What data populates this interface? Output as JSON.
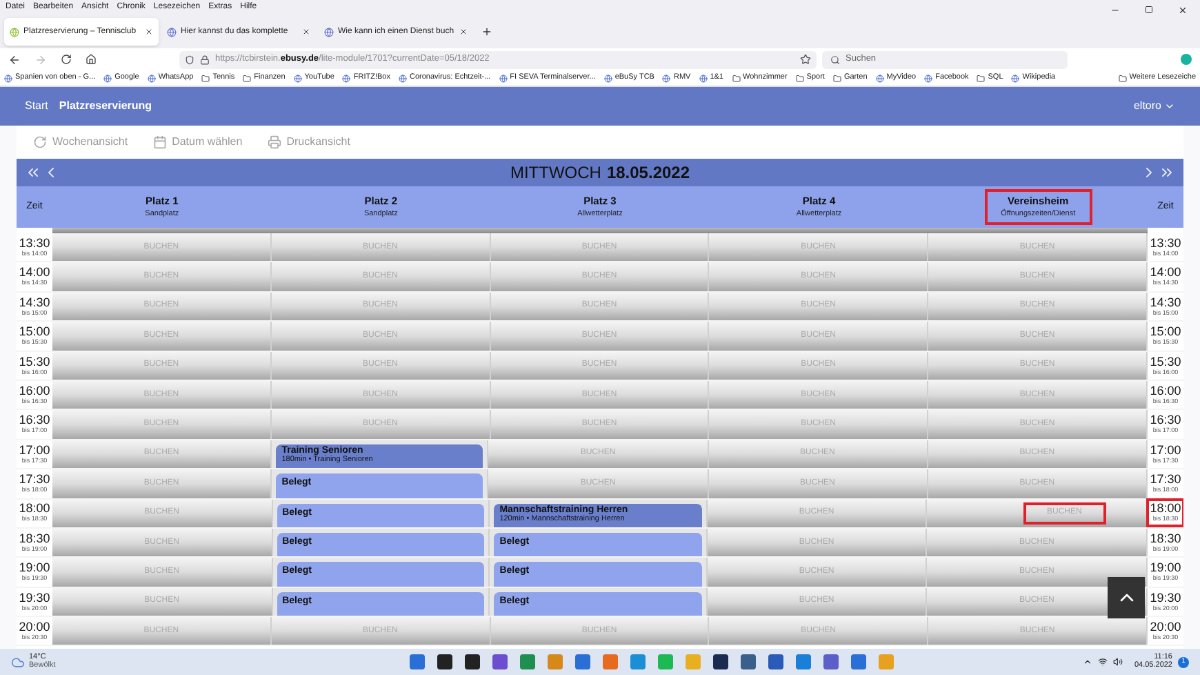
{
  "menu": [
    "Datei",
    "Bearbeiten",
    "Ansicht",
    "Chronik",
    "Lesezeichen",
    "Extras",
    "Hilfe"
  ],
  "tabs": [
    {
      "label": "Platzreservierung – Tennisclub",
      "selected": true
    },
    {
      "label": "Hier kannst du das komplette",
      "selected": false
    },
    {
      "label": "Wie kann ich einen Dienst buch",
      "selected": false
    }
  ],
  "address": {
    "url": "https://tcbirstein.**ebusy.de**/lite-module/1701?currentDate=05/18/2022"
  },
  "search": {
    "placeholder": "Suchen"
  },
  "bookmarks": [
    {
      "label": "Spanien von oben - G...",
      "kind": "site"
    },
    {
      "label": "Google",
      "kind": "site"
    },
    {
      "label": "WhatsApp",
      "kind": "site"
    },
    {
      "label": "Tennis",
      "kind": "folder"
    },
    {
      "label": "Finanzen",
      "kind": "folder"
    },
    {
      "label": "YouTube",
      "kind": "site"
    },
    {
      "label": "FRITZ!Box",
      "kind": "site"
    },
    {
      "label": "Coronavirus: Echtzeit-...",
      "kind": "site"
    },
    {
      "label": "FI SEVA Terminalserver...",
      "kind": "site"
    },
    {
      "label": "eBuSy TCB",
      "kind": "site"
    },
    {
      "label": "RMV",
      "kind": "site"
    },
    {
      "label": "1&1",
      "kind": "site"
    },
    {
      "label": "Wohnzimmer",
      "kind": "folder"
    },
    {
      "label": "Sport",
      "kind": "folder"
    },
    {
      "label": "Garten",
      "kind": "folder"
    },
    {
      "label": "MyVideo",
      "kind": "site"
    },
    {
      "label": "Facebook",
      "kind": "site"
    },
    {
      "label": "SQL",
      "kind": "folder"
    },
    {
      "label": "Wikipedia",
      "kind": "site"
    }
  ],
  "more_bookmarks": "Weitere Lesezeiche",
  "app_nav": {
    "items": [
      {
        "label": "Start",
        "selected": false
      },
      {
        "label": "Platzreservierung",
        "selected": true
      }
    ],
    "user": "eltoro"
  },
  "toolbar": [
    "Wochenansicht",
    "Datum wählen",
    "Druckansicht"
  ],
  "date_bar": {
    "weekday": "MITTWOCH",
    "date": "18.05.2022"
  },
  "time_heading": "Zeit",
  "time_heading_right": "Zeit",
  "courts": [
    {
      "name": "Platz 1",
      "type": "Sandplatz",
      "highlighted": false
    },
    {
      "name": "Platz 2",
      "type": "Sandplatz",
      "highlighted": false
    },
    {
      "name": "Platz 3",
      "type": "Allwetterplatz",
      "highlighted": false
    },
    {
      "name": "Platz 4",
      "type": "Allwetterplatz",
      "highlighted": false
    },
    {
      "name": "Vereinsheim",
      "type": "Öffnungszeiten/Dienst",
      "highlighted": true
    }
  ],
  "rows": [
    {
      "time": "13:30",
      "until": "bis 14:00",
      "cells": [
        {
          "kind": "free",
          "label": "BUCHEN",
          "highlighted": false
        },
        {
          "kind": "free",
          "label": "BUCHEN",
          "highlighted": false
        },
        {
          "kind": "free",
          "label": "BUCHEN",
          "highlighted": false
        },
        {
          "kind": "free",
          "label": "BUCHEN",
          "highlighted": false
        },
        {
          "kind": "free",
          "label": "BUCHEN",
          "highlighted": false
        }
      ]
    },
    {
      "time": "14:00",
      "until": "bis 14:30",
      "cells": [
        {
          "kind": "free",
          "label": "BUCHEN",
          "highlighted": false
        },
        {
          "kind": "free",
          "label": "BUCHEN",
          "highlighted": false
        },
        {
          "kind": "free",
          "label": "BUCHEN",
          "highlighted": false
        },
        {
          "kind": "free",
          "label": "BUCHEN",
          "highlighted": false
        },
        {
          "kind": "free",
          "label": "BUCHEN",
          "highlighted": false
        }
      ]
    },
    {
      "time": "14:30",
      "until": "bis 15:00",
      "cells": [
        {
          "kind": "free",
          "label": "BUCHEN",
          "highlighted": false
        },
        {
          "kind": "free",
          "label": "BUCHEN",
          "highlighted": false
        },
        {
          "kind": "free",
          "label": "BUCHEN",
          "highlighted": false
        },
        {
          "kind": "free",
          "label": "BUCHEN",
          "highlighted": false
        },
        {
          "kind": "free",
          "label": "BUCHEN",
          "highlighted": false
        }
      ]
    },
    {
      "time": "15:00",
      "until": "bis 15:30",
      "cells": [
        {
          "kind": "free",
          "label": "BUCHEN",
          "highlighted": false
        },
        {
          "kind": "free",
          "label": "BUCHEN",
          "highlighted": false
        },
        {
          "kind": "free",
          "label": "BUCHEN",
          "highlighted": false
        },
        {
          "kind": "free",
          "label": "BUCHEN",
          "highlighted": false
        },
        {
          "kind": "free",
          "label": "BUCHEN",
          "highlighted": false
        }
      ]
    },
    {
      "time": "15:30",
      "until": "bis 16:00",
      "cells": [
        {
          "kind": "free",
          "label": "BUCHEN",
          "highlighted": false
        },
        {
          "kind": "free",
          "label": "BUCHEN",
          "highlighted": false
        },
        {
          "kind": "free",
          "label": "BUCHEN",
          "highlighted": false
        },
        {
          "kind": "free",
          "label": "BUCHEN",
          "highlighted": false
        },
        {
          "kind": "free",
          "label": "BUCHEN",
          "highlighted": false
        }
      ]
    },
    {
      "time": "16:00",
      "until": "bis 16:30",
      "cells": [
        {
          "kind": "free",
          "label": "BUCHEN",
          "highlighted": false
        },
        {
          "kind": "free",
          "label": "BUCHEN",
          "highlighted": false
        },
        {
          "kind": "free",
          "label": "BUCHEN",
          "highlighted": false
        },
        {
          "kind": "free",
          "label": "BUCHEN",
          "highlighted": false
        },
        {
          "kind": "free",
          "label": "BUCHEN",
          "highlighted": false
        }
      ]
    },
    {
      "time": "16:30",
      "until": "bis 17:00",
      "cells": [
        {
          "kind": "free",
          "label": "BUCHEN",
          "highlighted": false
        },
        {
          "kind": "free",
          "label": "BUCHEN",
          "highlighted": false
        },
        {
          "kind": "free",
          "label": "BUCHEN",
          "highlighted": false
        },
        {
          "kind": "free",
          "label": "BUCHEN",
          "highlighted": false
        },
        {
          "kind": "free",
          "label": "BUCHEN",
          "highlighted": false
        }
      ]
    },
    {
      "time": "17:00",
      "until": "bis 17:30",
      "cells": [
        {
          "kind": "free",
          "label": "BUCHEN",
          "highlighted": false
        },
        {
          "kind": "booking",
          "title": "Training Senioren",
          "detail": "180min • Training Senioren"
        },
        {
          "kind": "free",
          "label": "BUCHEN",
          "highlighted": false
        },
        {
          "kind": "free",
          "label": "BUCHEN",
          "highlighted": false
        },
        {
          "kind": "free",
          "label": "BUCHEN",
          "highlighted": false
        }
      ]
    },
    {
      "time": "17:30",
      "until": "bis 18:00",
      "cells": [
        {
          "kind": "free",
          "label": "BUCHEN",
          "highlighted": false
        },
        {
          "kind": "occupied",
          "title": "Belegt"
        },
        {
          "kind": "free",
          "label": "BUCHEN",
          "highlighted": false
        },
        {
          "kind": "free",
          "label": "BUCHEN",
          "highlighted": false
        },
        {
          "kind": "free",
          "label": "BUCHEN",
          "highlighted": false
        }
      ]
    },
    {
      "time": "18:00",
      "until": "bis 18:30",
      "cells": [
        {
          "kind": "free",
          "label": "BUCHEN",
          "highlighted": false
        },
        {
          "kind": "occupied",
          "title": "Belegt"
        },
        {
          "kind": "booking",
          "title": "Mannschaftstraining Herren",
          "detail": "120min • Mannschaftstraining Herren"
        },
        {
          "kind": "free",
          "label": "BUCHEN",
          "highlighted": false
        },
        {
          "kind": "free",
          "label": "BUCHEN",
          "highlighted": true
        }
      ]
    },
    {
      "time": "18:30",
      "until": "bis 19:00",
      "cells": [
        {
          "kind": "free",
          "label": "BUCHEN",
          "highlighted": false
        },
        {
          "kind": "occupied",
          "title": "Belegt"
        },
        {
          "kind": "occupied",
          "title": "Belegt"
        },
        {
          "kind": "free",
          "label": "BUCHEN",
          "highlighted": false
        },
        {
          "kind": "free",
          "label": "BUCHEN",
          "highlighted": false
        }
      ]
    },
    {
      "time": "19:00",
      "until": "bis 19:30",
      "cells": [
        {
          "kind": "free",
          "label": "BUCHEN",
          "highlighted": false
        },
        {
          "kind": "occupied",
          "title": "Belegt"
        },
        {
          "kind": "occupied",
          "title": "Belegt"
        },
        {
          "kind": "free",
          "label": "BUCHEN",
          "highlighted": false
        },
        {
          "kind": "free",
          "label": "BUCHEN",
          "highlighted": false
        }
      ]
    },
    {
      "time": "19:30",
      "until": "bis 20:00",
      "cells": [
        {
          "kind": "free",
          "label": "BUCHEN",
          "highlighted": false
        },
        {
          "kind": "occupied",
          "title": "Belegt"
        },
        {
          "kind": "occupied",
          "title": "Belegt"
        },
        {
          "kind": "free",
          "label": "BUCHEN",
          "highlighted": false
        },
        {
          "kind": "free",
          "label": "BUCHEN",
          "highlighted": false
        }
      ]
    },
    {
      "time": "20:00",
      "until": "bis 20:30",
      "cells": [
        {
          "kind": "free",
          "label": "BUCHEN",
          "highlighted": false
        },
        {
          "kind": "free",
          "label": "BUCHEN",
          "highlighted": false
        },
        {
          "kind": "free",
          "label": "BUCHEN",
          "highlighted": false
        },
        {
          "kind": "free",
          "label": "BUCHEN",
          "highlighted": false
        },
        {
          "kind": "free",
          "label": "BUCHEN",
          "highlighted": false
        }
      ]
    }
  ],
  "right_times": [
    {
      "time": "13:30",
      "until": "bis 14:00",
      "highlighted": false
    },
    {
      "time": "14:00",
      "until": "bis 14:30",
      "highlighted": false
    },
    {
      "time": "14:30",
      "until": "bis 15:00",
      "highlighted": false
    },
    {
      "time": "15:00",
      "until": "bis 15:30",
      "highlighted": false
    },
    {
      "time": "15:30",
      "until": "bis 16:00",
      "highlighted": false
    },
    {
      "time": "16:00",
      "until": "bis 16:30",
      "highlighted": false
    },
    {
      "time": "16:30",
      "until": "bis 17:00",
      "highlighted": false
    },
    {
      "time": "17:00",
      "until": "bis 17:30",
      "highlighted": false
    },
    {
      "time": "17:30",
      "until": "bis 18:00",
      "highlighted": false
    },
    {
      "time": "18:00",
      "until": "bis 18:30",
      "highlighted": true
    },
    {
      "time": "18:30",
      "until": "bis 19:00",
      "highlighted": false
    },
    {
      "time": "19:00",
      "until": "bis 19:30",
      "highlighted": false
    },
    {
      "time": "19:30",
      "until": "bis 20:00",
      "highlighted": false
    },
    {
      "time": "20:00",
      "until": "bis 20:30",
      "highlighted": false
    }
  ],
  "taskbar": {
    "weather": {
      "temp": "14°C",
      "condition": "Bewölkt"
    },
    "clock": {
      "time": "11:16",
      "date": "04.05.2022"
    },
    "notifications": "1"
  }
}
